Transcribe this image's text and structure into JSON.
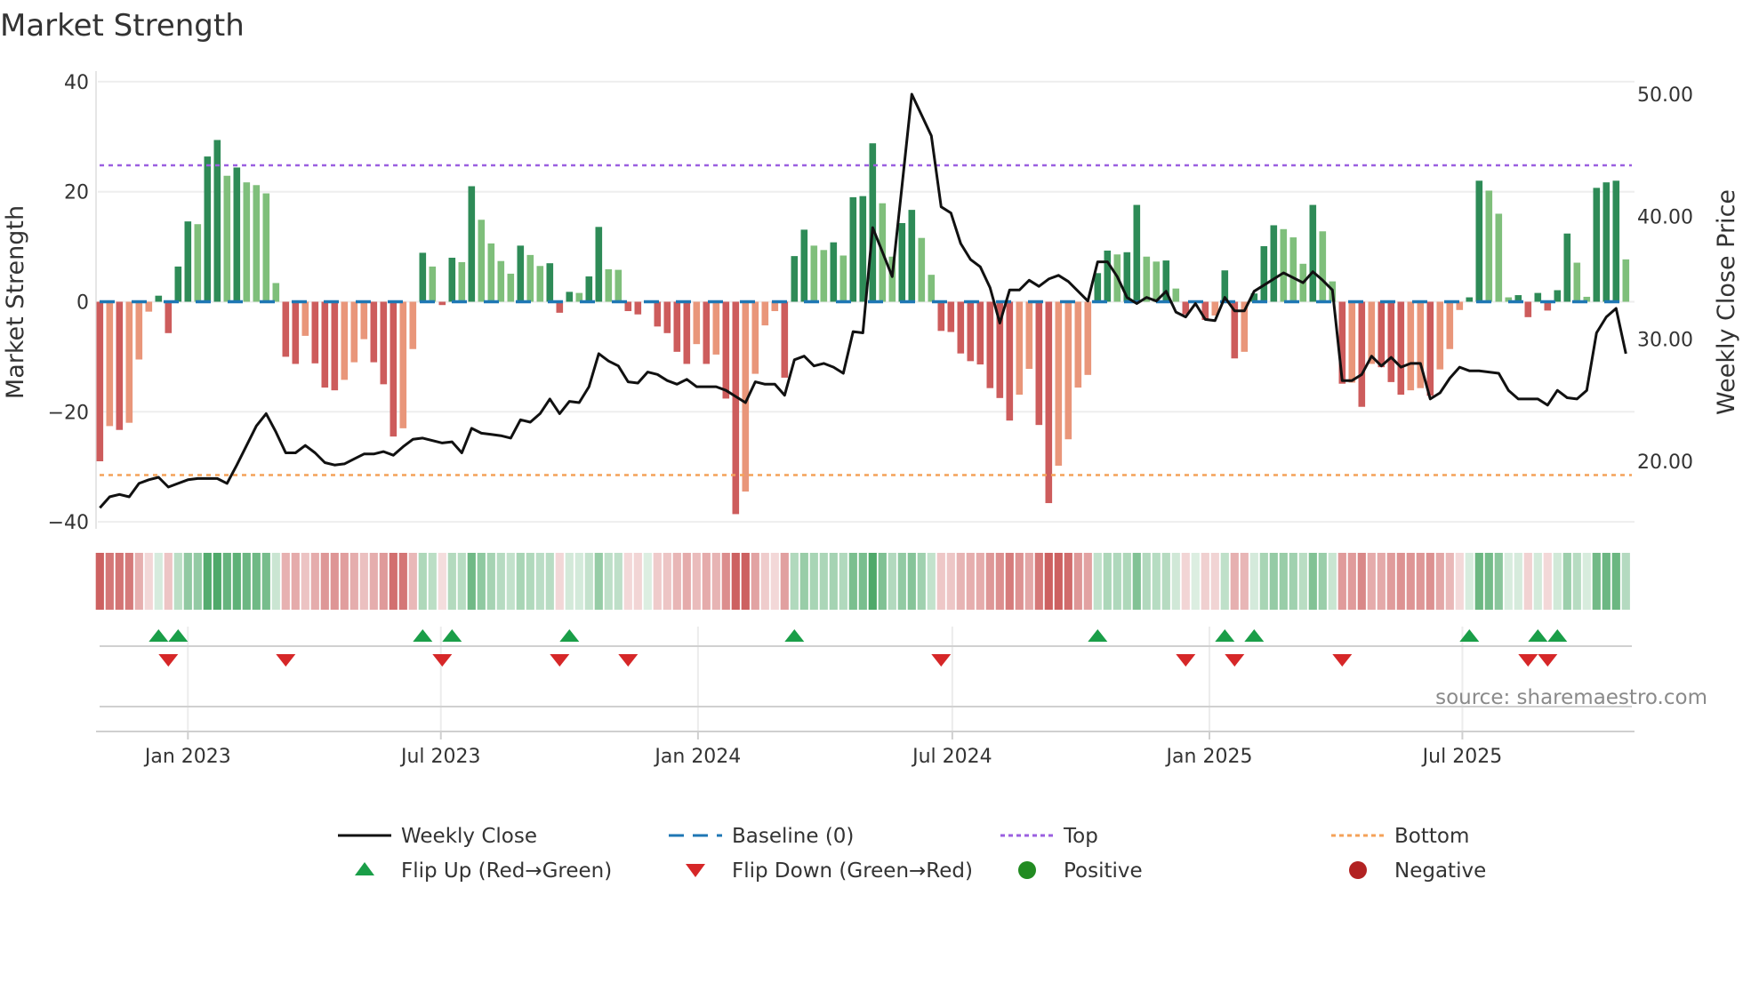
{
  "title": "Market Strength",
  "source": "source: sharemaestro.com",
  "colors": {
    "pos_strong": "#2e8b57",
    "pos_weak": "#7fbf7b",
    "neg_strong": "#cd5c5c",
    "neg_weak": "#e9967a",
    "baseline": "#1f77b4",
    "top": "#9b5fe0",
    "bottom": "#f4a259",
    "price": "#111111",
    "flip_up": "#1a9e48",
    "flip_down": "#d62728",
    "positive": "#228b22",
    "negative": "#b22222"
  },
  "chart_data": {
    "type": "bar+line",
    "title": "Market Strength",
    "x_start": "2022-10-30",
    "x_step": "weekly",
    "xlabel": "",
    "ylabel": "Market Strength",
    "y2label": "Weekly Close Price",
    "ylim": [
      -42,
      42
    ],
    "y2lim": [
      13.9,
      51
    ],
    "yticks": [
      "40",
      "20",
      "0",
      "−20",
      "−40"
    ],
    "ytick_values": [
      40,
      20,
      0,
      -20,
      -40
    ],
    "y2ticks": [
      "50.00",
      "40.00",
      "30.00",
      "20.00"
    ],
    "y2tick_values": [
      50,
      40,
      30,
      20
    ],
    "xticks": [
      {
        "label": "Jan 2023",
        "date": "2023-01-01"
      },
      {
        "label": "Jul 2023",
        "date": "2023-07-01"
      },
      {
        "label": "Jan 2024",
        "date": "2024-01-01"
      },
      {
        "label": "Jul 2024",
        "date": "2024-07-01"
      },
      {
        "label": "Jan 2025",
        "date": "2025-01-01"
      },
      {
        "label": "Jul 2025",
        "date": "2025-07-01"
      }
    ],
    "top_level": 24.8,
    "bottom_level": -31.5,
    "baseline": 0,
    "strength": [
      -29,
      -22.6,
      -23.3,
      -22,
      -10.5,
      -1.8,
      1.1,
      -5.7,
      6.4,
      14.6,
      14.1,
      26.4,
      29.4,
      22.9,
      24.4,
      21.7,
      21.2,
      19.7,
      3.4,
      -10,
      -11.3,
      -6.2,
      -11.2,
      -15.6,
      -16.1,
      -14.2,
      -11,
      -6.8,
      -11,
      -15,
      -24.5,
      -23,
      -8.6,
      8.9,
      6.4,
      -0.6,
      8,
      7.2,
      21,
      14.9,
      10.6,
      7.4,
      5.1,
      10.2,
      8.5,
      6.5,
      7.0,
      -2.0,
      1.8,
      1.6,
      4.6,
      13.6,
      5.9,
      5.8,
      -1.7,
      -2.3,
      0,
      -4.5,
      -5.7,
      -9.1,
      -11.3,
      -7.7,
      -11.3,
      -9.6,
      -17.6,
      -38.6,
      -34.5,
      -13.1,
      -4.3,
      -1.7,
      -13.8,
      8.3,
      13.1,
      10.2,
      9.4,
      10.8,
      8.4,
      19.0,
      19.2,
      28.8,
      17.9,
      8.2,
      14.3,
      16.7,
      11.6,
      4.9,
      -5.3,
      -5.5,
      -9.4,
      -10.8,
      -11.4,
      -15.7,
      -17.5,
      -21.6,
      -16.9,
      -12.2,
      -22.4,
      -36.6,
      -29.8,
      -25,
      -15.6,
      -13.3,
      5.2,
      9.3,
      8.6,
      9.0,
      17.6,
      8.2,
      7.3,
      7.5,
      2.4,
      -2.3,
      0,
      -3.3,
      -2.5,
      5.7,
      -10.3,
      -9.1,
      1.5,
      10.1,
      13.9,
      13.2,
      11.7,
      6.9,
      17.6,
      12.8,
      3.7,
      -14.9,
      -14.7,
      -19.1,
      -11.3,
      -11.9,
      -14.6,
      -16.9,
      -16.1,
      -15.7,
      -17.1,
      -12.3,
      -8.6,
      -1.5,
      0.8,
      22.0,
      20.2,
      16.0,
      0.8,
      1.2,
      -2.8,
      1.6,
      -1.6,
      2.1,
      12.4,
      7.1,
      0.9,
      20.7,
      21.7,
      22.0,
      7.7
    ],
    "weekly_close": [
      16.2,
      17.1,
      17.3,
      17.1,
      18.2,
      18.5,
      18.7,
      17.9,
      18.2,
      18.5,
      18.6,
      18.6,
      18.6,
      18.2,
      19.7,
      21.3,
      22.9,
      23.9,
      22.4,
      20.7,
      20.7,
      21.3,
      20.7,
      19.9,
      19.7,
      19.8,
      20.2,
      20.6,
      20.6,
      20.8,
      20.5,
      21.2,
      21.8,
      21.9,
      21.7,
      21.5,
      21.6,
      20.7,
      22.7,
      22.3,
      22.2,
      22.1,
      21.9,
      23.4,
      23.2,
      23.9,
      25.1,
      23.9,
      24.9,
      24.8,
      26.1,
      28.8,
      28.2,
      27.8,
      26.5,
      26.4,
      27.3,
      27.1,
      26.6,
      26.3,
      26.7,
      26.1,
      26.1,
      26.1,
      25.8,
      25.3,
      24.8,
      26.5,
      26.3,
      26.3,
      25.4,
      28.3,
      28.6,
      27.8,
      28.0,
      27.7,
      27.2,
      30.6,
      30.5,
      39.1,
      37.1,
      35.1,
      42.5,
      50.0,
      48.3,
      46.6,
      40.8,
      40.3,
      37.8,
      36.5,
      35.9,
      34.2,
      31.3,
      34.0,
      34.0,
      34.8,
      34.3,
      34.9,
      35.2,
      34.7,
      33.9,
      33.1,
      36.3,
      36.3,
      35.1,
      33.4,
      32.9,
      33.4,
      33.1,
      33.9,
      32.2,
      31.8,
      32.9,
      31.6,
      31.5,
      33.4,
      32.3,
      32.3,
      33.9,
      34.4,
      34.9,
      35.4,
      35.0,
      34.6,
      35.5,
      34.8,
      34.0,
      26.6,
      26.6,
      27.1,
      28.6,
      27.8,
      28.5,
      27.7,
      28.0,
      28.0,
      25.1,
      25.6,
      26.8,
      27.7,
      27.4,
      27.4,
      27.3,
      27.2,
      25.8,
      25.1,
      25.1,
      25.1,
      24.6,
      25.8,
      25.2,
      25.1,
      25.8,
      30.5,
      31.8,
      32.5,
      28.8
    ],
    "legend": {
      "placement": "bottom",
      "items": [
        {
          "label": "Weekly Close",
          "icon": "line-solid"
        },
        {
          "label": "Baseline (0)",
          "icon": "line-dashed"
        },
        {
          "label": "Top",
          "icon": "line-dotted-purple"
        },
        {
          "label": "Bottom",
          "icon": "line-dotted-orange"
        },
        {
          "label": "Flip Up (Red→Green)",
          "icon": "triangle-up"
        },
        {
          "label": "Flip Down (Green→Red)",
          "icon": "triangle-down"
        },
        {
          "label": "Positive",
          "icon": "dot-green"
        },
        {
          "label": "Negative",
          "icon": "dot-red"
        }
      ]
    }
  }
}
